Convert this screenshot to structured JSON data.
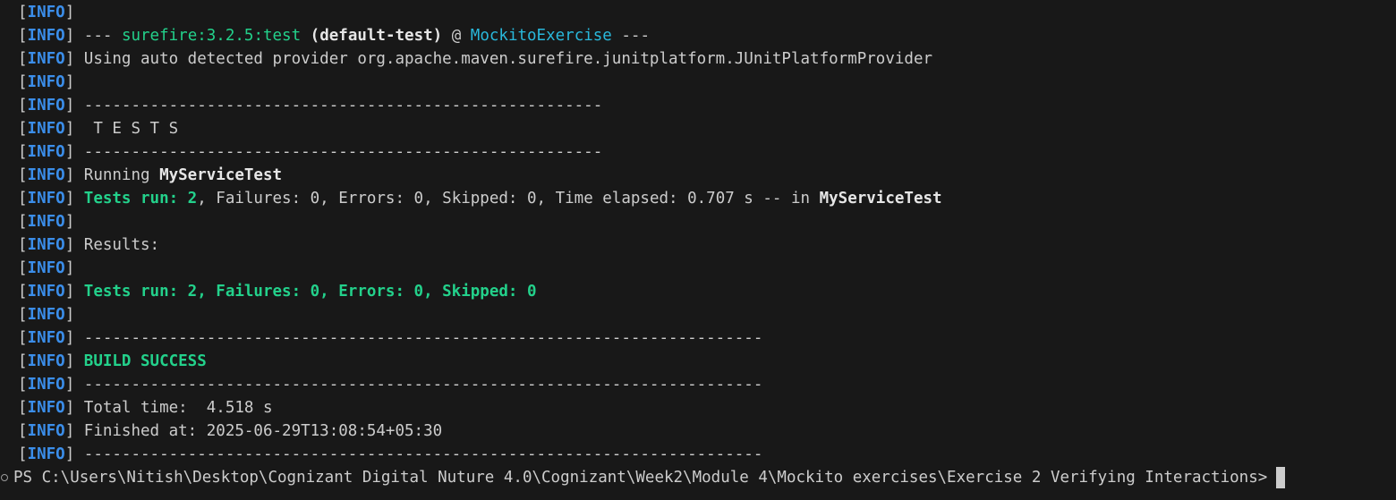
{
  "log_level": "INFO",
  "lines": [
    {
      "segments": []
    },
    {
      "segments": [
        {
          "text": "--- ",
          "style": "plain"
        },
        {
          "text": "surefire:3.2.5:test",
          "style": "green"
        },
        {
          "text": " ",
          "style": "plain"
        },
        {
          "text": "(default-test)",
          "style": "plain-bold"
        },
        {
          "text": " @ ",
          "style": "plain"
        },
        {
          "text": "MockitoExercise",
          "style": "cyan"
        },
        {
          "text": " ---",
          "style": "plain"
        }
      ]
    },
    {
      "segments": [
        {
          "text": "Using auto detected provider org.apache.maven.surefire.junitplatform.JUnitPlatformProvider",
          "style": "plain"
        }
      ]
    },
    {
      "segments": []
    },
    {
      "segments": [
        {
          "text": "-------------------------------------------------------",
          "style": "plain"
        }
      ]
    },
    {
      "segments": [
        {
          "text": " T E S T S",
          "style": "plain"
        }
      ]
    },
    {
      "segments": [
        {
          "text": "-------------------------------------------------------",
          "style": "plain"
        }
      ]
    },
    {
      "segments": [
        {
          "text": "Running ",
          "style": "plain"
        },
        {
          "text": "MyServiceTest",
          "style": "plain-bold"
        }
      ]
    },
    {
      "segments": [
        {
          "text": "Tests run: 2",
          "style": "green-bold"
        },
        {
          "text": ", Failures: 0, Errors: 0, Skipped: 0, Time elapsed: 0.707 s -- in ",
          "style": "plain"
        },
        {
          "text": "MyServiceTest",
          "style": "plain-bold"
        }
      ]
    },
    {
      "segments": []
    },
    {
      "segments": [
        {
          "text": "Results:",
          "style": "plain"
        }
      ]
    },
    {
      "segments": []
    },
    {
      "segments": [
        {
          "text": "Tests run: 2, Failures: 0, Errors: 0, Skipped: 0",
          "style": "green-bold"
        }
      ]
    },
    {
      "segments": []
    },
    {
      "segments": [
        {
          "text": "------------------------------------------------------------------------",
          "style": "plain"
        }
      ]
    },
    {
      "segments": [
        {
          "text": "BUILD SUCCESS",
          "style": "green-bold"
        }
      ]
    },
    {
      "segments": [
        {
          "text": "------------------------------------------------------------------------",
          "style": "plain"
        }
      ]
    },
    {
      "segments": [
        {
          "text": "Total time:  4.518 s",
          "style": "plain"
        }
      ]
    },
    {
      "segments": [
        {
          "text": "Finished at: 2025-06-29T13:08:54+05:30",
          "style": "plain"
        }
      ]
    },
    {
      "segments": [
        {
          "text": "------------------------------------------------------------------------",
          "style": "plain"
        }
      ]
    }
  ],
  "prompt": {
    "text": "PS C:\\Users\\Nitish\\Desktop\\Cognizant Digital Nuture 4.0\\Cognizant\\Week2\\Module 4\\Mockito exercises\\Exercise 2 Verifying Interactions>"
  },
  "colors": {
    "background": "#181818",
    "info": "#3b8eea",
    "green": "#23d18b",
    "cyan": "#29b8db",
    "text": "#cccccc"
  }
}
